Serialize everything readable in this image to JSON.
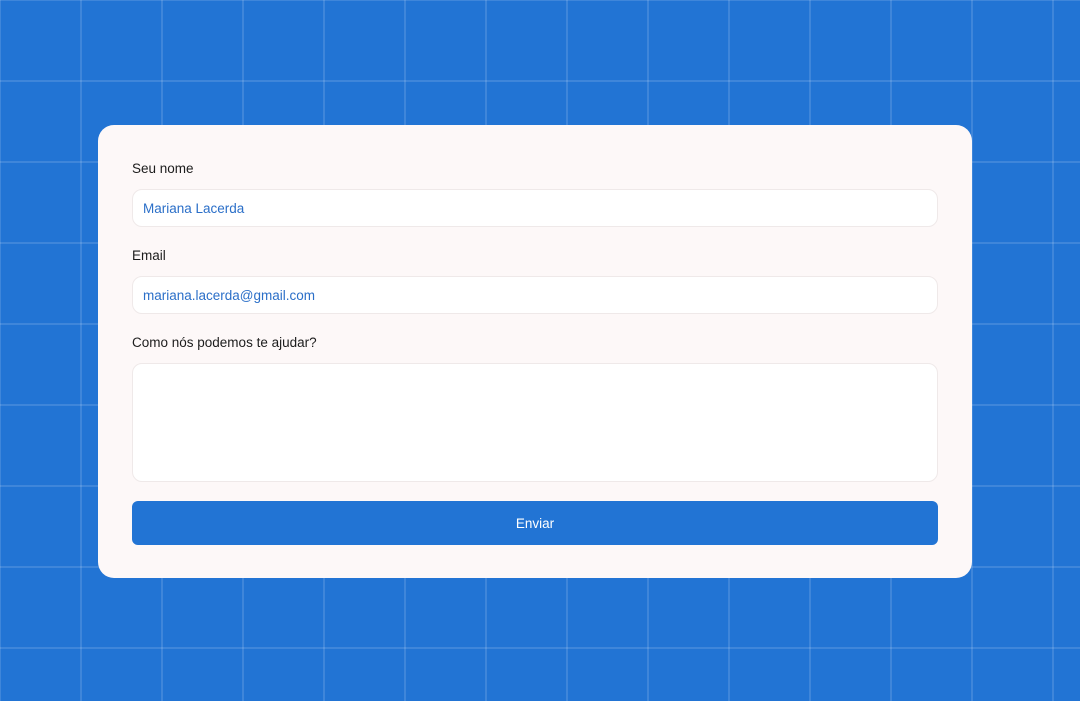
{
  "form": {
    "name_label": "Seu nome",
    "name_value": "Mariana Lacerda",
    "email_label": "Email",
    "email_value": "mariana.lacerda@gmail.com",
    "message_label": "Como nós podemos te ajudar?",
    "message_value": "",
    "submit_label": "Enviar"
  },
  "colors": {
    "background": "#2274d4",
    "card": "#fdf8f8",
    "accent": "#2274d4",
    "input_text": "#2b6fc8"
  }
}
